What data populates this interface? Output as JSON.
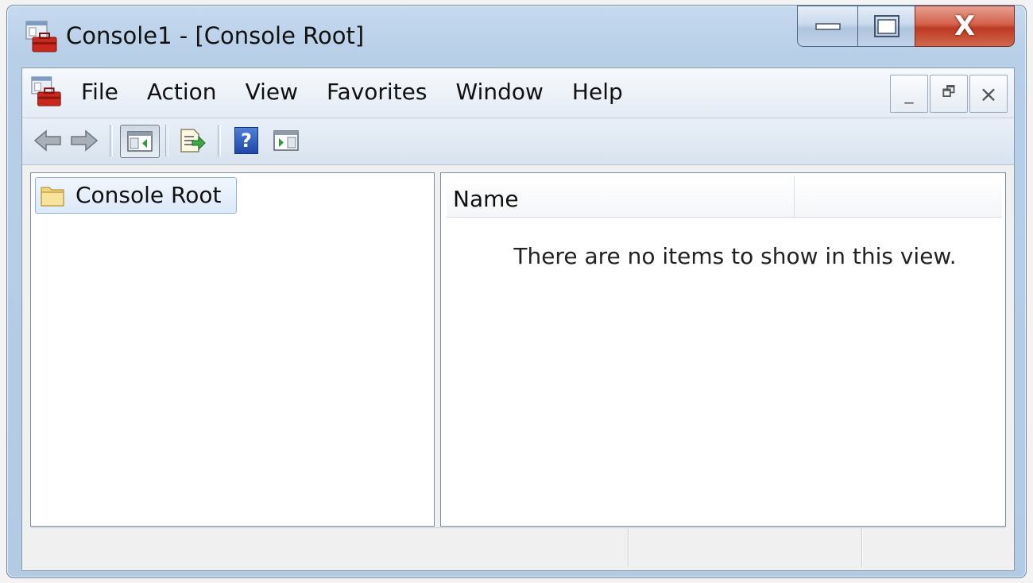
{
  "window": {
    "title": "Console1 - [Console Root]",
    "icon": "toolbox-icon",
    "caption_buttons": [
      "minimize-icon",
      "maximize-icon",
      "close-icon"
    ],
    "close_glyph": "X"
  },
  "menu": {
    "items": [
      "File",
      "Action",
      "View",
      "Favorites",
      "Window",
      "Help"
    ],
    "mdi_buttons": {
      "minimize": "_",
      "restore": "🗗",
      "close": "×"
    }
  },
  "toolbar": {
    "buttons": [
      "back-arrow-icon",
      "forward-arrow-icon",
      "show-hide-console-tree-icon",
      "export-list-icon",
      "help-icon",
      "show-hide-action-pane-icon"
    ],
    "help_glyph": "?"
  },
  "tree": {
    "nodes": [
      {
        "label": "Console Root",
        "icon": "folder-icon",
        "selected": true
      }
    ]
  },
  "list": {
    "columns": [
      "Name",
      ""
    ],
    "empty_message": "There are no items to show in this view."
  },
  "colors": {
    "title_bar": "#c6daef",
    "close_button": "#c9452c",
    "selection_border": "#8db2e3",
    "folder": "#f4d57a"
  }
}
